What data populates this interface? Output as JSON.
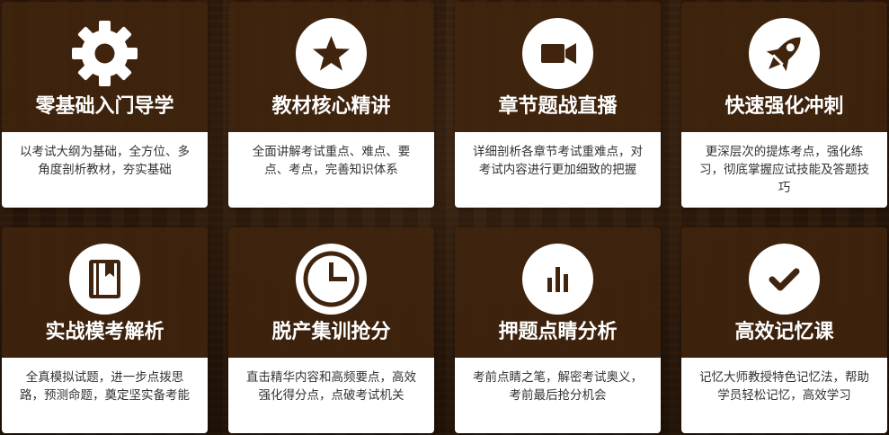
{
  "colors": {
    "card_top": "#40240e",
    "icon_glyph": "#40240e",
    "card_bottom": "#ffffff",
    "title_text": "#ffffff",
    "desc_text": "#333333"
  },
  "cards": [
    {
      "icon": "gear-icon",
      "title": "零基础入门导学",
      "desc": "以考试大纲为基础，全方位、多角度剖析教材，夯实基础"
    },
    {
      "icon": "star-icon",
      "title": "教材核心精讲",
      "desc": "全面讲解考试重点、难点、要点、考点，完善知识体系"
    },
    {
      "icon": "video-camera-icon",
      "title": "章节题战直播",
      "desc": "详细剖析各章节考试重难点，对考试内容进行更加细致的把握"
    },
    {
      "icon": "rocket-icon",
      "title": "快速强化冲刺",
      "desc": "更深层次的提炼考点，强化练习，彻底掌握应试技能及答题技巧"
    },
    {
      "icon": "book-icon",
      "title": "实战模考解析",
      "desc": "全真模拟试题，进一步点拨思路，预测命题，奠定坚实备考能"
    },
    {
      "icon": "clock-icon",
      "title": "脱产集训抢分",
      "desc": "直击精华内容和高频要点，高效强化得分点，点破考试机关"
    },
    {
      "icon": "bar-chart-icon",
      "title": "押题点睛分析",
      "desc": "考前点睛之笔，解密考试奥义，考前最后抢分机会"
    },
    {
      "icon": "checkmark-icon",
      "title": "高效记忆课",
      "desc": "记忆大师教授特色记忆法，帮助学员轻松记忆，高效学习"
    }
  ]
}
